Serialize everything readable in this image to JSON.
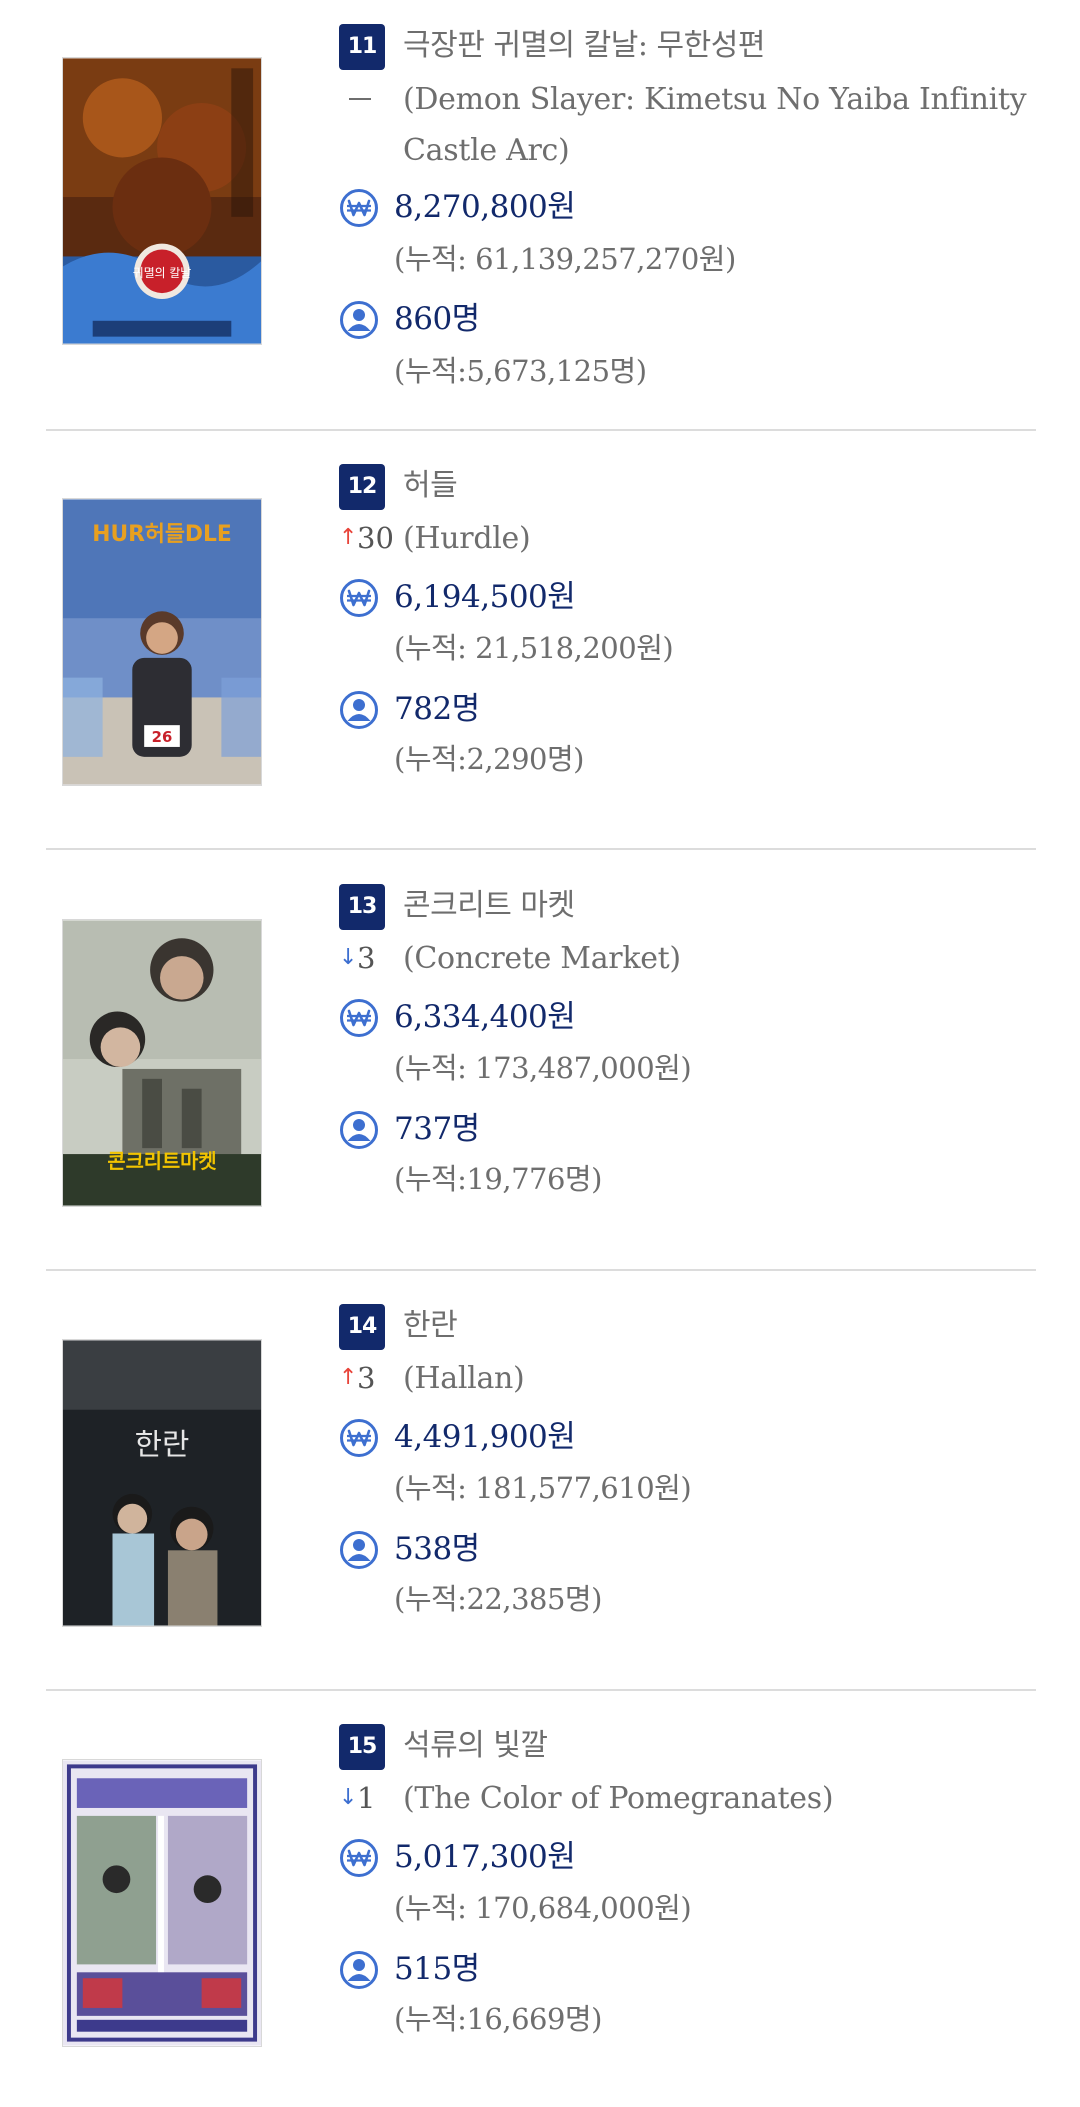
{
  "movies": [
    {
      "rank": "11",
      "title": "극장판 귀멸의 칼날: 무한성편",
      "change_dir": "none",
      "change_value": "",
      "original_title": "(Demon Slayer: Kimetsu No Yaiba Infinity Castle Arc)",
      "sales": "8,270,800원",
      "sales_total": "(누적: 61,139,257,270원)",
      "audience": "860명",
      "audience_total": "(누적:5,673,125명)"
    },
    {
      "rank": "12",
      "title": "허들",
      "change_dir": "up",
      "change_value": "30",
      "original_title": "(Hurdle)",
      "sales": "6,194,500원",
      "sales_total": "(누적: 21,518,200원)",
      "audience": "782명",
      "audience_total": "(누적:2,290명)"
    },
    {
      "rank": "13",
      "title": "콘크리트 마켓",
      "change_dir": "down",
      "change_value": "3",
      "original_title": "(Concrete Market)",
      "sales": "6,334,400원",
      "sales_total": "(누적: 173,487,000원)",
      "audience": "737명",
      "audience_total": "(누적:19,776명)"
    },
    {
      "rank": "14",
      "title": "한란",
      "change_dir": "up",
      "change_value": "3",
      "original_title": "(Hallan)",
      "sales": "4,491,900원",
      "sales_total": "(누적: 181,577,610원)",
      "audience": "538명",
      "audience_total": "(누적:22,385명)"
    },
    {
      "rank": "15",
      "title": "석류의 빛깔",
      "change_dir": "down",
      "change_value": "1",
      "original_title": "(The Color of Pomegranates)",
      "sales": "5,017,300원",
      "sales_total": "(누적: 170,684,000원)",
      "audience": "515명",
      "audience_total": "(누적:16,669명)"
    }
  ],
  "posters": [
    {
      "text": "귀멸의 칼날"
    },
    {
      "text": "HUR허들DLE",
      "bib": "26"
    },
    {
      "text": "콘크리트마켓"
    },
    {
      "text": "한란"
    },
    {
      "text": ""
    }
  ],
  "icons": {
    "sales": "won-coin-icon",
    "audience": "person-icon"
  },
  "colors": {
    "navy": "#12296b",
    "icon_blue": "#3d6fd0",
    "up": "#e8443a",
    "down": "#3d6fd0",
    "gray": "#6e6e6e"
  }
}
